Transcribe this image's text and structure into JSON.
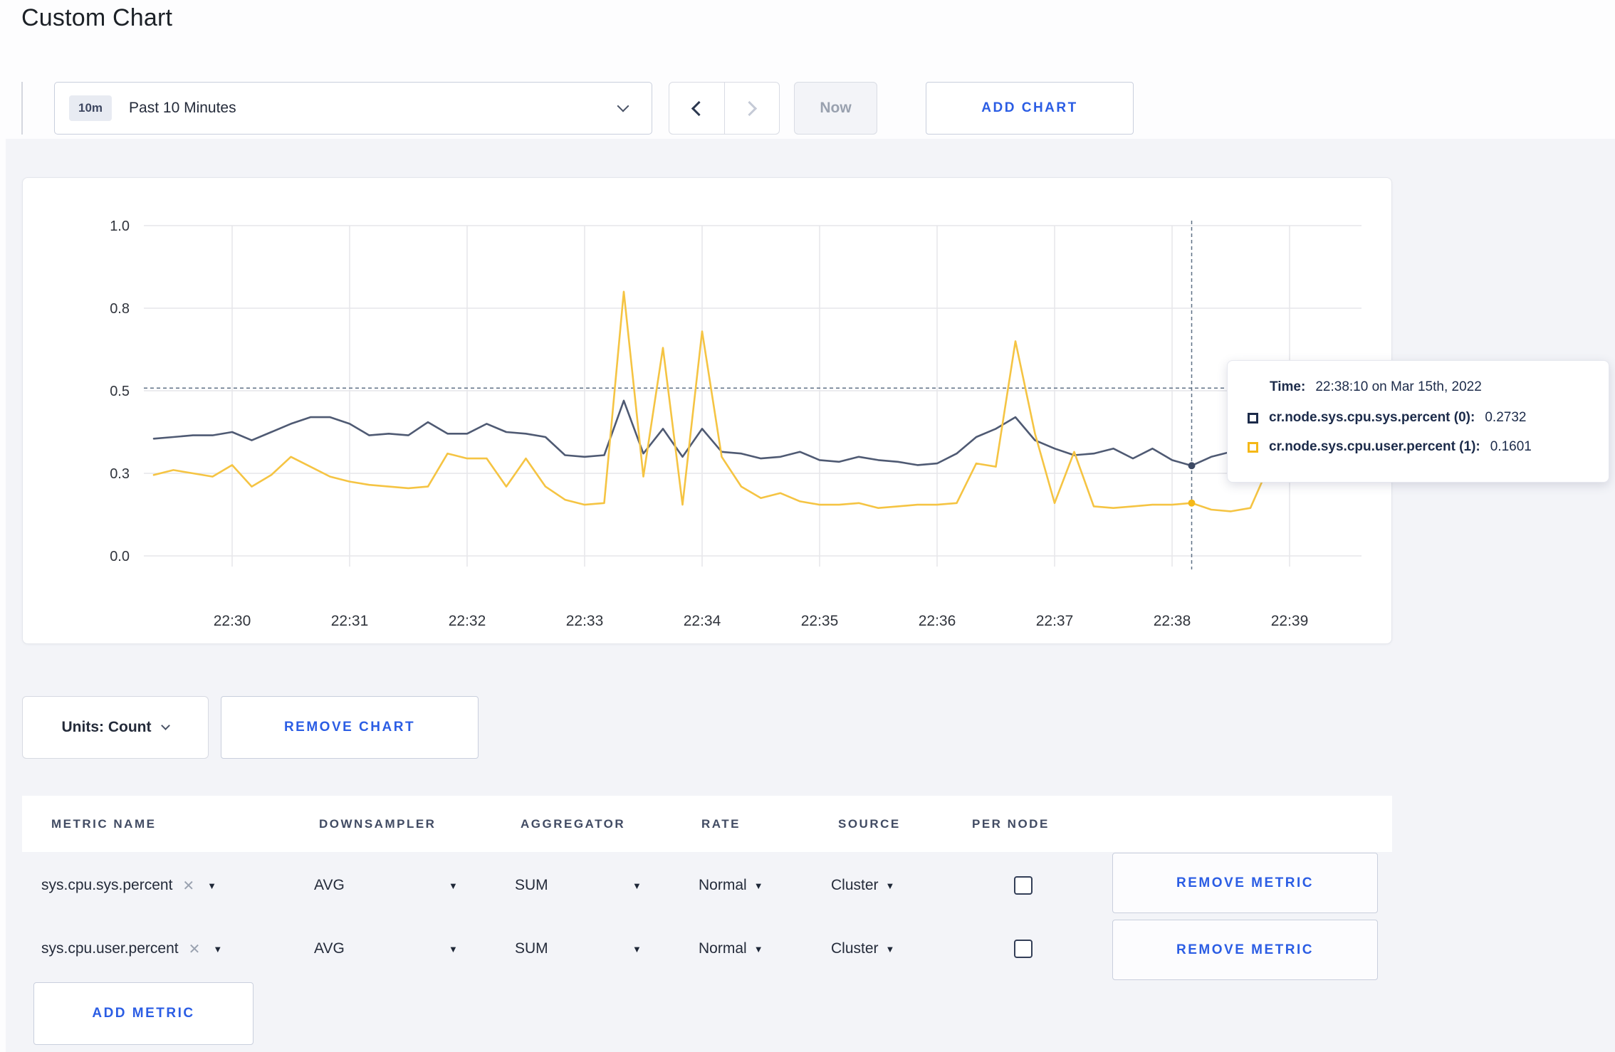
{
  "page": {
    "title": "Custom Chart"
  },
  "colors": {
    "accent_blue": "#2b5de4",
    "navy": "#1c2b4a",
    "page_bg": "#f3f4f8",
    "grid": "#e6e6ea",
    "crosshair": "#5f7186",
    "series_sys": "#4f5a73",
    "series_sys_marker": "#3c4964",
    "series_user": "#f5c443",
    "series_user_marker": "#f5b817"
  },
  "toolbar": {
    "range_badge": "10m",
    "range_label": "Past 10 Minutes",
    "now_label": "Now",
    "add_chart_label": "ADD CHART"
  },
  "chart_data": {
    "type": "line",
    "x_start": "22:29:20",
    "x_interval_seconds": 10,
    "x_tick_labels": [
      "22:30",
      "22:31",
      "22:32",
      "22:33",
      "22:34",
      "22:35",
      "22:36",
      "22:37",
      "22:38",
      "22:39"
    ],
    "y_ticks": [
      {
        "label": "1.0",
        "value": 1.0
      },
      {
        "label": "0.8",
        "value": 0.75
      },
      {
        "label": "0.5",
        "value": 0.5
      },
      {
        "label": "0.3",
        "value": 0.25
      },
      {
        "label": "0.0",
        "value": 0.0
      }
    ],
    "ylim": [
      0,
      1
    ],
    "grid": true,
    "series": [
      {
        "name": "cr.node.sys.cpu.sys.percent (0)",
        "color": "#4f5a73",
        "marker_color": "#3c4964",
        "values": [
          0.355,
          0.36,
          0.365,
          0.365,
          0.375,
          0.35,
          0.375,
          0.4,
          0.42,
          0.42,
          0.4,
          0.365,
          0.37,
          0.365,
          0.405,
          0.37,
          0.37,
          0.4,
          0.375,
          0.37,
          0.36,
          0.305,
          0.3,
          0.305,
          0.47,
          0.31,
          0.385,
          0.3,
          0.385,
          0.315,
          0.31,
          0.295,
          0.3,
          0.315,
          0.29,
          0.285,
          0.3,
          0.29,
          0.285,
          0.275,
          0.28,
          0.31,
          0.36,
          0.385,
          0.42,
          0.35,
          0.325,
          0.305,
          0.31,
          0.325,
          0.295,
          0.325,
          0.29,
          0.2732,
          0.3,
          0.315,
          0.3,
          0.31,
          0.305,
          0.3
        ]
      },
      {
        "name": "cr.node.sys.cpu.user.percent (1)",
        "color": "#f5c443",
        "marker_color": "#f5b817",
        "values": [
          0.245,
          0.26,
          0.25,
          0.24,
          0.275,
          0.21,
          0.245,
          0.3,
          0.27,
          0.24,
          0.225,
          0.215,
          0.21,
          0.205,
          0.21,
          0.31,
          0.295,
          0.295,
          0.21,
          0.295,
          0.21,
          0.17,
          0.155,
          0.16,
          0.8,
          0.24,
          0.63,
          0.155,
          0.68,
          0.3,
          0.21,
          0.175,
          0.19,
          0.165,
          0.155,
          0.155,
          0.16,
          0.145,
          0.15,
          0.155,
          0.155,
          0.16,
          0.28,
          0.27,
          0.65,
          0.37,
          0.16,
          0.315,
          0.15,
          0.145,
          0.15,
          0.155,
          0.155,
          0.1601,
          0.14,
          0.135,
          0.145,
          0.28,
          0.27,
          0.235
        ]
      }
    ],
    "crosshair": {
      "index": 53,
      "time": "22:38:10",
      "hover_value": 0.508
    }
  },
  "tooltip": {
    "time_label": "Time:",
    "time_value": "22:38:10 on Mar 15th, 2022",
    "rows": [
      {
        "name": "cr.node.sys.cpu.sys.percent (0):",
        "value": "0.2732",
        "square_color": "#1c2b4a"
      },
      {
        "name": "cr.node.sys.cpu.user.percent (1):",
        "value": "0.1601",
        "square_color": "#f5b817"
      }
    ]
  },
  "units_row": {
    "units_label": "Units: Count",
    "remove_chart_label": "REMOVE CHART"
  },
  "table": {
    "headers": [
      "METRIC NAME",
      "DOWNSAMPLER",
      "AGGREGATOR",
      "RATE",
      "SOURCE",
      "PER NODE"
    ],
    "rows": [
      {
        "metric": "sys.cpu.sys.percent",
        "downsampler": "AVG",
        "aggregator": "SUM",
        "rate": "Normal",
        "source": "Cluster",
        "per_node": false,
        "remove_label": "REMOVE METRIC"
      },
      {
        "metric": "sys.cpu.user.percent",
        "downsampler": "AVG",
        "aggregator": "SUM",
        "rate": "Normal",
        "source": "Cluster",
        "per_node": false,
        "remove_label": "REMOVE METRIC"
      }
    ],
    "add_metric_label": "ADD METRIC"
  }
}
